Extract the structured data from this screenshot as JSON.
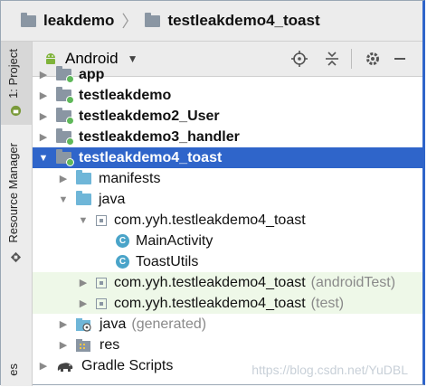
{
  "breadcrumb": {
    "items": [
      "leakdemo",
      "testleakdemo4_toast"
    ]
  },
  "side_strip": {
    "tabs": [
      "1: Project",
      "Resource Manager",
      "es"
    ]
  },
  "toolbar": {
    "view_label": "Android"
  },
  "tree": {
    "rows": [
      {
        "name": "app"
      },
      {
        "name": "testleakdemo"
      },
      {
        "name": "testleakdemo2_User"
      },
      {
        "name": "testleakdemo3_handler"
      },
      {
        "name": "testleakdemo4_toast"
      },
      {
        "name": "manifests"
      },
      {
        "name": "java"
      },
      {
        "name": "com.yyh.testleakdemo4_toast"
      },
      {
        "name": "MainActivity"
      },
      {
        "name": "ToastUtils"
      },
      {
        "name": "com.yyh.testleakdemo4_toast",
        "suffix": "(androidTest)"
      },
      {
        "name": "com.yyh.testleakdemo4_toast",
        "suffix": "(test)"
      },
      {
        "name": "java",
        "suffix": "(generated)"
      },
      {
        "name": "res"
      },
      {
        "name": "Gradle Scripts"
      }
    ]
  },
  "class_icon_letter": "C",
  "watermark": "https://blog.csdn.net/YuDBL",
  "colors": {
    "selection": "#2f65ca",
    "test_row_bg": "#eef8e8",
    "module_dot": "#5fb85a",
    "class_icon": "#4aa4c9"
  }
}
